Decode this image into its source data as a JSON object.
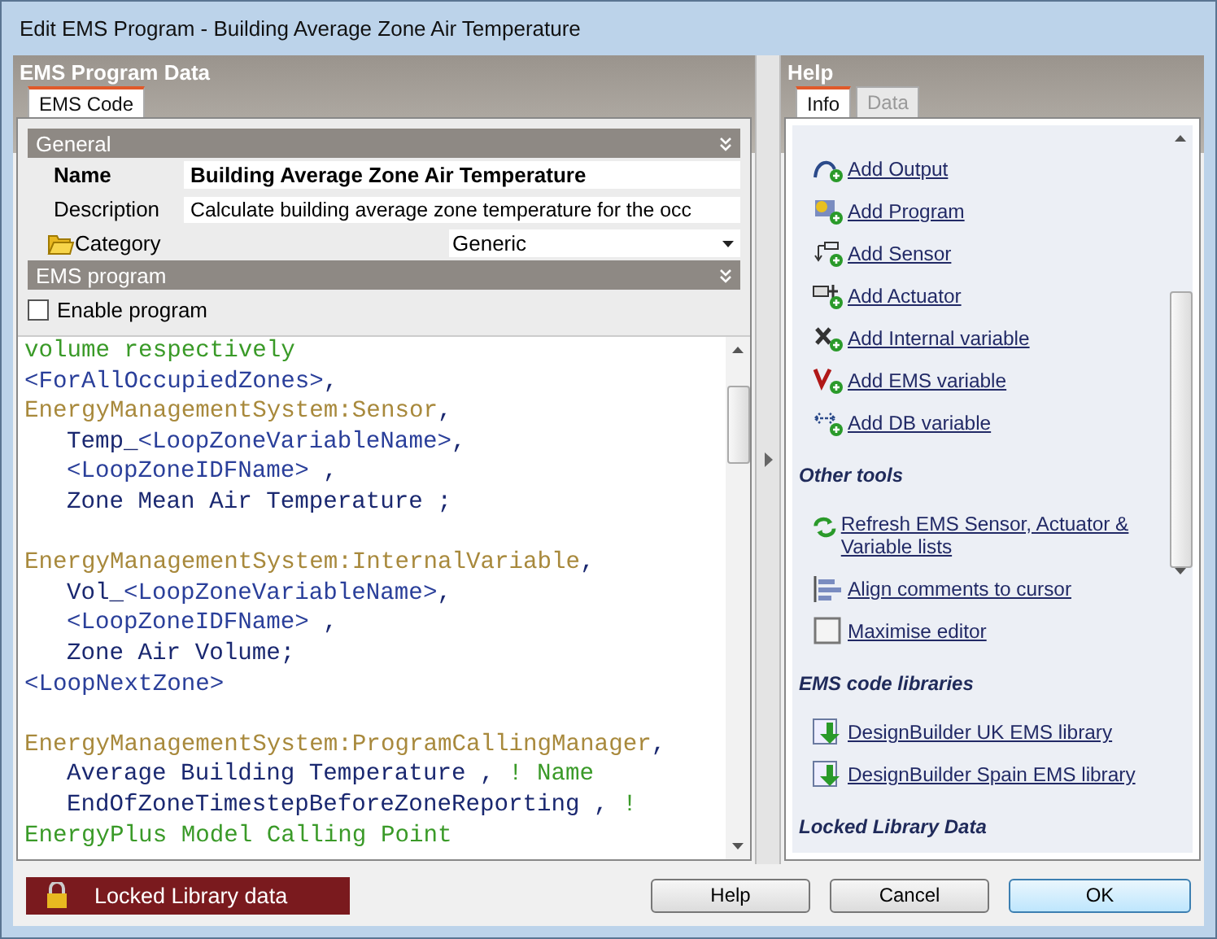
{
  "window": {
    "title": "Edit EMS Program - Building Average Zone Air Temperature"
  },
  "left_panel": {
    "title": "EMS Program Data",
    "tabs": [
      {
        "label": "EMS Code",
        "selected": true
      }
    ],
    "sections": [
      {
        "title": "General",
        "fields": [
          {
            "kind": "text",
            "label": "Name",
            "value": "Building Average Zone Air Temperature",
            "bold": true
          },
          {
            "kind": "text",
            "label": "Description",
            "value": "Calculate building average zone temperature for the occ",
            "bold": false
          },
          {
            "kind": "dropdown",
            "label": "Category",
            "value": "Generic",
            "bold": false
          }
        ]
      },
      {
        "title": "EMS program",
        "fields": [
          {
            "kind": "checkbox",
            "label": "Enable program",
            "checked": false
          }
        ]
      }
    ],
    "code_lines": [
      {
        "kind": "code",
        "indented": false,
        "segments": [
          {
            "kind": "comment",
            "text": "volume respectively"
          }
        ]
      },
      {
        "kind": "code",
        "indented": false,
        "segments": [
          {
            "kind": "tag",
            "text": "<ForAllOccupiedZones>"
          },
          {
            "kind": "text",
            "text": ","
          }
        ]
      },
      {
        "kind": "code",
        "indented": false,
        "segments": [
          {
            "kind": "keyword",
            "text": "EnergyManagementSystem:Sensor"
          },
          {
            "kind": "text",
            "text": ","
          }
        ]
      },
      {
        "kind": "code",
        "indented": true,
        "segments": [
          {
            "kind": "text",
            "text": "Temp_"
          },
          {
            "kind": "tag",
            "text": "<LoopZoneVariableName>"
          },
          {
            "kind": "text",
            "text": ","
          }
        ]
      },
      {
        "kind": "code",
        "indented": true,
        "segments": [
          {
            "kind": "tag",
            "text": "<LoopZoneIDFName>"
          },
          {
            "kind": "text",
            "text": " ,"
          }
        ]
      },
      {
        "kind": "code",
        "indented": true,
        "segments": [
          {
            "kind": "text",
            "text": "Zone Mean Air Temperature ;"
          }
        ]
      },
      {
        "kind": "blank"
      },
      {
        "kind": "code",
        "indented": false,
        "segments": [
          {
            "kind": "keyword",
            "text": "EnergyManagementSystem:InternalVariable"
          },
          {
            "kind": "text",
            "text": ","
          }
        ]
      },
      {
        "kind": "code",
        "indented": true,
        "segments": [
          {
            "kind": "text",
            "text": "Vol_"
          },
          {
            "kind": "tag",
            "text": "<LoopZoneVariableName>"
          },
          {
            "kind": "text",
            "text": ","
          }
        ]
      },
      {
        "kind": "code",
        "indented": true,
        "segments": [
          {
            "kind": "tag",
            "text": "<LoopZoneIDFName>"
          },
          {
            "kind": "text",
            "text": " ,"
          }
        ]
      },
      {
        "kind": "code",
        "indented": true,
        "segments": [
          {
            "kind": "text",
            "text": "Zone Air Volume;"
          }
        ]
      },
      {
        "kind": "code",
        "indented": false,
        "segments": [
          {
            "kind": "tag",
            "text": "<LoopNextZone>"
          }
        ]
      },
      {
        "kind": "blank"
      },
      {
        "kind": "code",
        "indented": false,
        "segments": [
          {
            "kind": "keyword",
            "text": "EnergyManagementSystem:ProgramCallingManager"
          },
          {
            "kind": "text",
            "text": ","
          }
        ]
      },
      {
        "kind": "code",
        "indented": true,
        "segments": [
          {
            "kind": "text",
            "text": "Average Building Temperature , "
          },
          {
            "kind": "comment",
            "text": "! Name"
          }
        ]
      },
      {
        "kind": "code",
        "indented": true,
        "segments": [
          {
            "kind": "text",
            "text": "EndOfZoneTimestepBeforeZoneReporting , "
          },
          {
            "kind": "comment",
            "text": "!"
          }
        ]
      },
      {
        "kind": "code",
        "indented": false,
        "segments": [
          {
            "kind": "comment",
            "text": "EnergyPlus Model Calling Point"
          }
        ]
      }
    ]
  },
  "help_panel": {
    "title": "Help",
    "tabs": [
      {
        "label": "Info",
        "selected": true
      },
      {
        "label": "Data",
        "selected": false
      }
    ],
    "items": [
      {
        "kind": "link",
        "text": "Add Output"
      },
      {
        "kind": "link",
        "text": "Add Program"
      },
      {
        "kind": "link",
        "text": "Add Sensor"
      },
      {
        "kind": "link",
        "text": "Add Actuator"
      },
      {
        "kind": "link",
        "text": "Add Internal variable"
      },
      {
        "kind": "link",
        "text": "Add EMS variable"
      },
      {
        "kind": "link",
        "text": "Add DB variable"
      },
      {
        "kind": "heading",
        "text": "Other tools"
      },
      {
        "kind": "wide-link",
        "text": "Refresh EMS Sensor, Actuator & Variable lists"
      },
      {
        "kind": "link",
        "text": "Align comments to cursor"
      },
      {
        "kind": "link",
        "text": "Maximise editor"
      },
      {
        "kind": "heading",
        "text": "EMS code libraries"
      },
      {
        "kind": "link",
        "text": "DesignBuilder UK EMS library"
      },
      {
        "kind": "link",
        "text": "DesignBuilder Spain EMS library"
      },
      {
        "kind": "heading",
        "text": "Locked Library Data"
      }
    ]
  },
  "status": {
    "text": "Locked Library data"
  },
  "buttons": [
    {
      "label": "Help",
      "default": false
    },
    {
      "label": "Cancel",
      "default": false
    },
    {
      "label": "OK",
      "default": true
    }
  ]
}
